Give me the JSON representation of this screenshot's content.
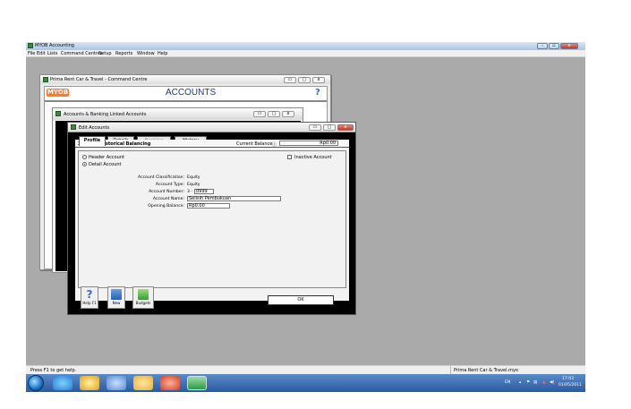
{
  "app": {
    "title": "MYOB Accounting",
    "menu": [
      "File",
      "Edit",
      "Lists",
      "Command Centres",
      "Setup",
      "Reports",
      "Window",
      "Help"
    ],
    "status_left": "Press F1 to get help.",
    "status_right": "Prima Rent Car & Travel.myo"
  },
  "command_centre": {
    "title": "Prima Rent Car & Travel - Command Centre",
    "logo": "MYOB",
    "heading": "ACCOUNTS"
  },
  "linked": {
    "title": "Accounts & Banking Linked Accounts"
  },
  "edit": {
    "title": "Edit Accounts",
    "tabs": [
      "Profile",
      "Details",
      "Banking",
      "History"
    ],
    "account_code": "3-0999",
    "section": "Historical Balancing",
    "current_balance_label": "Current Balance",
    "current_balance_value": "Rp0.00",
    "header_account": "Header Account",
    "detail_account": "Detail Account",
    "inactive_account": "Inactive Account",
    "classification_label": "Account Classification:",
    "classification_value": "Equity",
    "type_label": "Account Type:",
    "type_value": "Equity",
    "number_label": "Account Number:",
    "number_prefix": "3 -",
    "number_value": "0999",
    "name_label": "Account Name:",
    "name_value": "Selisih Pembukuan",
    "opening_label": "Opening Balance:",
    "opening_value": "Rp0.00",
    "buttons": {
      "help": "Help F1",
      "new": "New",
      "budgets": "Budgets",
      "ok": "OK"
    }
  },
  "taskbar": {
    "lang": "EN",
    "time": "17:03",
    "date": "01/05/2011"
  },
  "colors": {
    "titlebar_blue": "#a9c4e6",
    "myob_orange": "#ff7a2a",
    "accounts_blue": "#1d3a8e",
    "taskbar": "#2a5aa0"
  }
}
